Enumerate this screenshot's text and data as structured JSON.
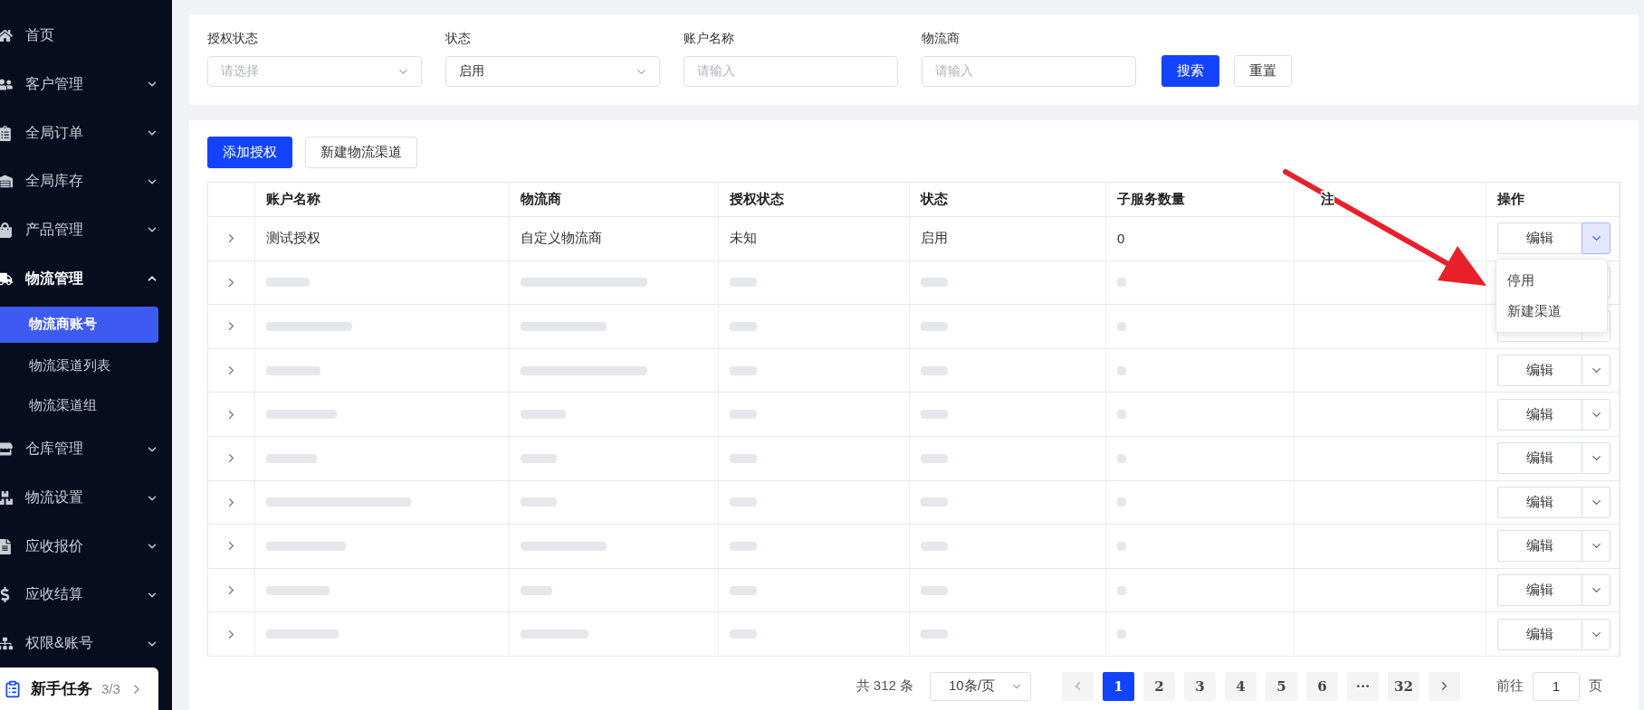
{
  "sidebar": {
    "items": [
      {
        "label": "首页",
        "kind": "link",
        "expanded": false
      },
      {
        "label": "客户管理",
        "kind": "group",
        "expanded": false
      },
      {
        "label": "全局订单",
        "kind": "group",
        "expanded": false
      },
      {
        "label": "全局库存",
        "kind": "group",
        "expanded": false
      },
      {
        "label": "产品管理",
        "kind": "group",
        "expanded": false
      },
      {
        "label": "物流管理",
        "kind": "group",
        "expanded": true,
        "children": [
          {
            "label": "物流商账号",
            "selected": true
          },
          {
            "label": "物流渠道列表",
            "selected": false
          },
          {
            "label": "物流渠道组",
            "selected": false
          }
        ]
      },
      {
        "label": "仓库管理",
        "kind": "group",
        "expanded": false
      },
      {
        "label": "物流设置",
        "kind": "group",
        "expanded": false
      },
      {
        "label": "应收报价",
        "kind": "group",
        "expanded": false
      },
      {
        "label": "应收结算",
        "kind": "group",
        "expanded": false
      },
      {
        "label": "权限&账号",
        "kind": "group",
        "expanded": false
      }
    ],
    "task_card": {
      "label": "新手任务",
      "progress": "3/3"
    }
  },
  "filters": [
    {
      "label": "授权状态",
      "kind": "select",
      "placeholder": "请选择"
    },
    {
      "label": "状态",
      "kind": "select",
      "value": "启用"
    },
    {
      "label": "账户名称",
      "kind": "input",
      "placeholder": "请输入"
    },
    {
      "label": "物流商",
      "kind": "input",
      "placeholder": "请输入"
    }
  ],
  "filter_buttons": [
    {
      "label": "搜索",
      "kind": "primary"
    },
    {
      "label": "重置",
      "kind": "default"
    }
  ],
  "toolbar_buttons": [
    {
      "label": "添加授权",
      "kind": "primary"
    },
    {
      "label": "新建物流渠道",
      "kind": "default"
    }
  ],
  "table": {
    "columns": [
      "账户名称",
      "物流商",
      "授权状态",
      "状态",
      "子服务数量",
      "注",
      "操作"
    ],
    "rows": [
      {
        "cells": [
          "测试授权",
          "自定义物流商",
          "未知",
          "启用",
          "0",
          ""
        ],
        "blurred": false,
        "action": "编辑",
        "menu_open": true,
        "menu": [
          "停用",
          "新建渠道"
        ]
      },
      {
        "blurred": true,
        "menu_open": false
      },
      {
        "blurred": true,
        "menu_open": false
      },
      {
        "blurred": true,
        "action": "编辑",
        "menu_open": false
      },
      {
        "blurred": true,
        "action": "编辑",
        "menu_open": false
      },
      {
        "blurred": true,
        "action": "编辑",
        "menu_open": false
      },
      {
        "blurred": true,
        "action": "编辑",
        "menu_open": false
      },
      {
        "blurred": true,
        "action": "编辑",
        "menu_open": false
      },
      {
        "blurred": true,
        "action": "编辑",
        "menu_open": false
      },
      {
        "blurred": true,
        "action": "编辑",
        "menu_open": false
      }
    ]
  },
  "pagination": {
    "total": "共 312 条",
    "page_size": "10条/页",
    "pages": [
      {
        "label": "1",
        "selected": true
      },
      {
        "label": "2",
        "selected": false
      },
      {
        "label": "3",
        "selected": false
      },
      {
        "label": "4",
        "selected": false
      },
      {
        "label": "5",
        "selected": false
      },
      {
        "label": "6",
        "selected": false
      },
      {
        "label": "···",
        "selected": false
      },
      {
        "label": "32",
        "selected": false
      }
    ],
    "jump_label": "前往",
    "jump_value": "1",
    "jump_suffix": "页"
  }
}
